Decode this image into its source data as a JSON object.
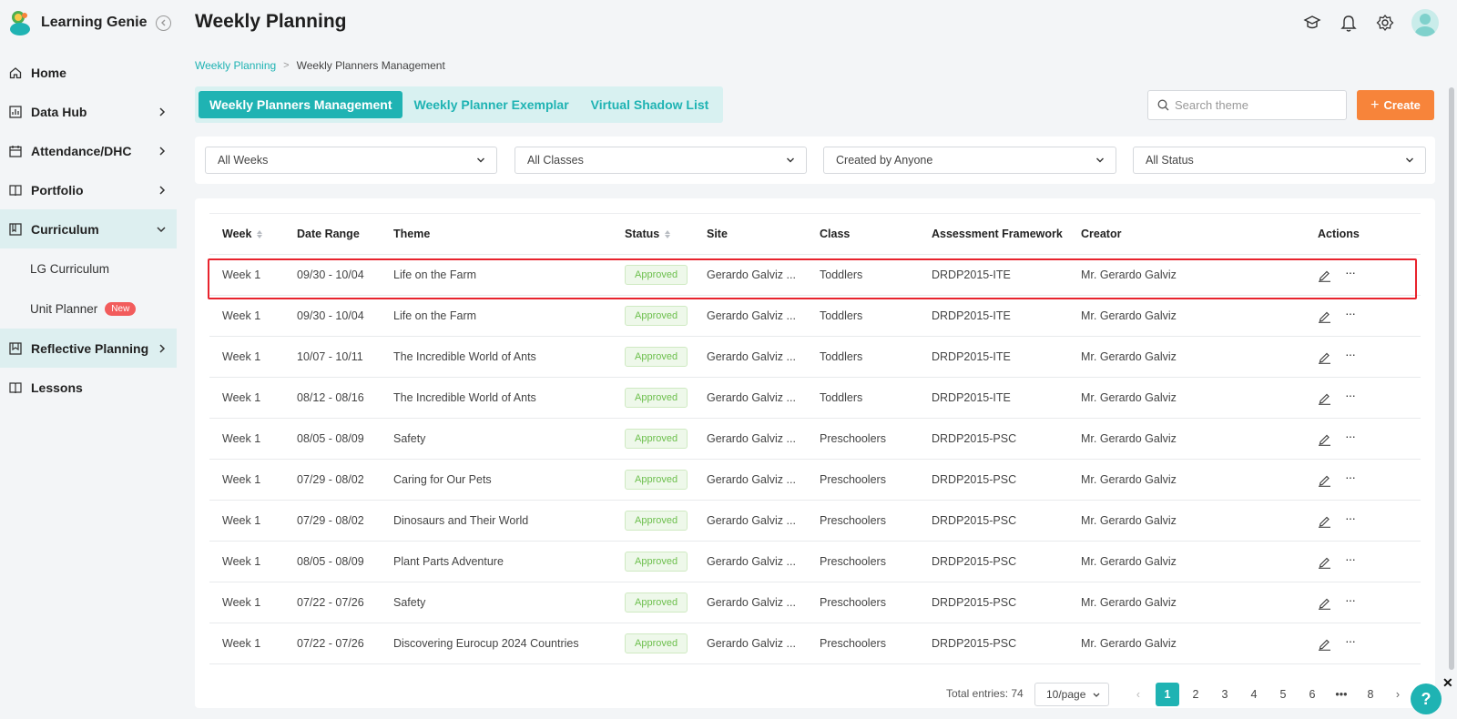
{
  "app": {
    "name": "Learning Genie"
  },
  "sidebar": {
    "items": [
      {
        "label": "Home",
        "icon": "home-icon"
      },
      {
        "label": "Data Hub",
        "icon": "chart-icon"
      },
      {
        "label": "Attendance/DHC",
        "icon": "calendar-icon"
      },
      {
        "label": "Portfolio",
        "icon": "book-icon"
      },
      {
        "label": "Curriculum",
        "icon": "curriculum-icon"
      },
      {
        "label": "Reflective Planning",
        "icon": "bookmark-icon"
      },
      {
        "label": "Lessons",
        "icon": "lessons-icon"
      }
    ],
    "sub_items": [
      {
        "label": "LG Curriculum"
      },
      {
        "label": "Unit Planner",
        "badge": "New"
      }
    ]
  },
  "header": {
    "title": "Weekly Planning"
  },
  "breadcrumb": {
    "parent": "Weekly Planning",
    "current": "Weekly Planners Management"
  },
  "tabs": [
    {
      "label": "Weekly Planners Management",
      "active": true
    },
    {
      "label": "Weekly Planner Exemplar",
      "active": false
    },
    {
      "label": "Virtual Shadow List",
      "active": false
    }
  ],
  "search": {
    "placeholder": "Search theme",
    "value": ""
  },
  "create_button": {
    "label": "Create"
  },
  "filters": {
    "weeks": "All Weeks",
    "classes": "All Classes",
    "creator": "Created by Anyone",
    "status": "All Status"
  },
  "table": {
    "columns": [
      "Week",
      "Date Range",
      "Theme",
      "Status",
      "Site",
      "Class",
      "Assessment Framework",
      "Creator",
      "Actions"
    ],
    "rows": [
      {
        "week": "Week 1",
        "date": "09/30 - 10/04",
        "theme": "Life on the Farm",
        "status": "Approved",
        "site": "Gerardo Galviz ...",
        "class": "Toddlers",
        "framework": "DRDP2015-ITE",
        "creator": "Mr. Gerardo Galviz"
      },
      {
        "week": "Week 1",
        "date": "09/30 - 10/04",
        "theme": "Life on the Farm",
        "status": "Approved",
        "site": "Gerardo Galviz ...",
        "class": "Toddlers",
        "framework": "DRDP2015-ITE",
        "creator": "Mr. Gerardo Galviz"
      },
      {
        "week": "Week 1",
        "date": "10/07 - 10/11",
        "theme": "The Incredible World of Ants",
        "status": "Approved",
        "site": "Gerardo Galviz ...",
        "class": "Toddlers",
        "framework": "DRDP2015-ITE",
        "creator": "Mr. Gerardo Galviz"
      },
      {
        "week": "Week 1",
        "date": "08/12 - 08/16",
        "theme": "The Incredible World of Ants",
        "status": "Approved",
        "site": "Gerardo Galviz ...",
        "class": "Toddlers",
        "framework": "DRDP2015-ITE",
        "creator": "Mr. Gerardo Galviz"
      },
      {
        "week": "Week 1",
        "date": "08/05 - 08/09",
        "theme": "Safety",
        "status": "Approved",
        "site": "Gerardo Galviz ...",
        "class": "Preschoolers",
        "framework": "DRDP2015-PSC",
        "creator": "Mr. Gerardo Galviz"
      },
      {
        "week": "Week 1",
        "date": "07/29 - 08/02",
        "theme": "Caring for Our Pets",
        "status": "Approved",
        "site": "Gerardo Galviz ...",
        "class": "Preschoolers",
        "framework": "DRDP2015-PSC",
        "creator": "Mr. Gerardo Galviz"
      },
      {
        "week": "Week 1",
        "date": "07/29 - 08/02",
        "theme": "Dinosaurs and Their World",
        "status": "Approved",
        "site": "Gerardo Galviz ...",
        "class": "Preschoolers",
        "framework": "DRDP2015-PSC",
        "creator": "Mr. Gerardo Galviz"
      },
      {
        "week": "Week 1",
        "date": "08/05 - 08/09",
        "theme": "Plant Parts Adventure",
        "status": "Approved",
        "site": "Gerardo Galviz ...",
        "class": "Preschoolers",
        "framework": "DRDP2015-PSC",
        "creator": "Mr. Gerardo Galviz"
      },
      {
        "week": "Week 1",
        "date": "07/22 - 07/26",
        "theme": "Safety",
        "status": "Approved",
        "site": "Gerardo Galviz ...",
        "class": "Preschoolers",
        "framework": "DRDP2015-PSC",
        "creator": "Mr. Gerardo Galviz"
      },
      {
        "week": "Week 1",
        "date": "07/22 - 07/26",
        "theme": "Discovering Eurocup 2024 Countries",
        "status": "Approved",
        "site": "Gerardo Galviz ...",
        "class": "Preschoolers",
        "framework": "DRDP2015-PSC",
        "creator": "Mr. Gerardo Galviz"
      }
    ]
  },
  "pagination": {
    "total_label": "Total entries: 74",
    "page_size": "10/page",
    "pages": [
      "1",
      "2",
      "3",
      "4",
      "5",
      "6",
      "•••",
      "8"
    ],
    "current": "1"
  },
  "help": {
    "label": "?"
  },
  "colors": {
    "accent": "#1fb3b3",
    "create": "#f7843a",
    "approved": "#6cbf4c",
    "highlight": "#e8232d"
  }
}
